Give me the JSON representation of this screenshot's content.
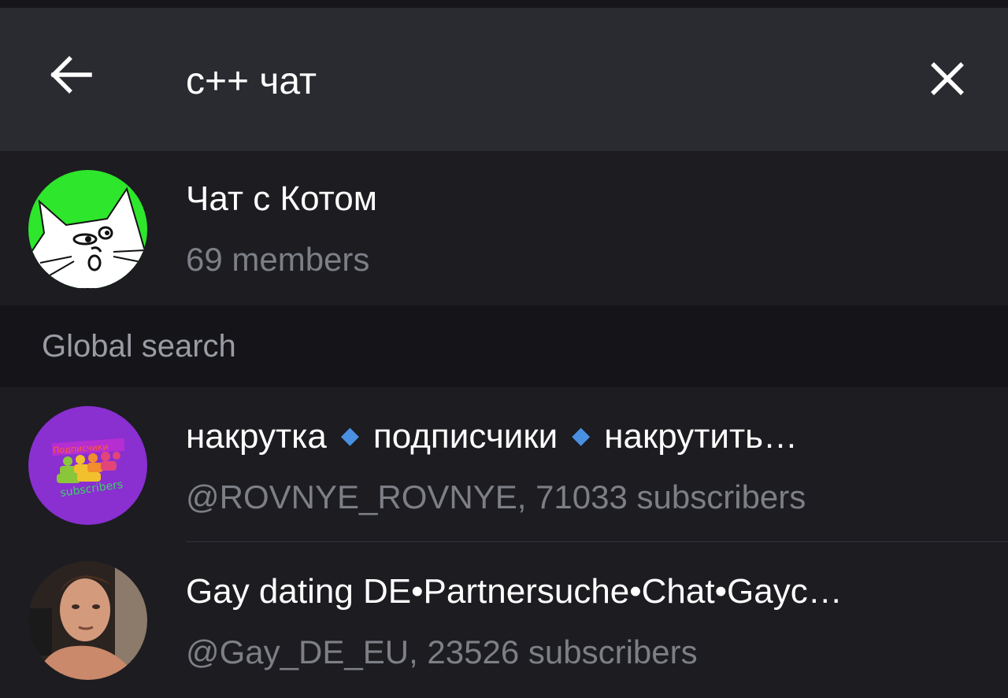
{
  "search": {
    "query": "c++ чат",
    "back_icon": "arrow-left-icon",
    "clear_icon": "close-icon"
  },
  "local_results": [
    {
      "title": "Чат с Котом",
      "subtitle": "69 members",
      "avatar": "cat-avatar",
      "avatar_bg": "#2ee62b"
    }
  ],
  "global_section": {
    "title": "Global search"
  },
  "global_results": [
    {
      "title_parts": [
        "накрутка",
        "подписчики",
        "накрутить…"
      ],
      "separator_icon": "blue-diamond-icon",
      "subtitle": "@ROVNYE_ROVNYE, 71033 subscribers",
      "avatar": "subscribers-avatar",
      "avatar_bg": "#8a2fd0",
      "avatar_text_top": "Подписчики",
      "avatar_text_bottom": "subscribers"
    },
    {
      "title": "Gay dating DE•Partnersuche•Chat•Gayc…",
      "subtitle": "@Gay_DE_EU, 23526 subscribers",
      "avatar": "photo-avatar"
    }
  ],
  "colors": {
    "header_bg": "#2a2a31",
    "list_bg": "#1c1c21",
    "section_bg": "#151519",
    "accent": "#4a90e2"
  }
}
